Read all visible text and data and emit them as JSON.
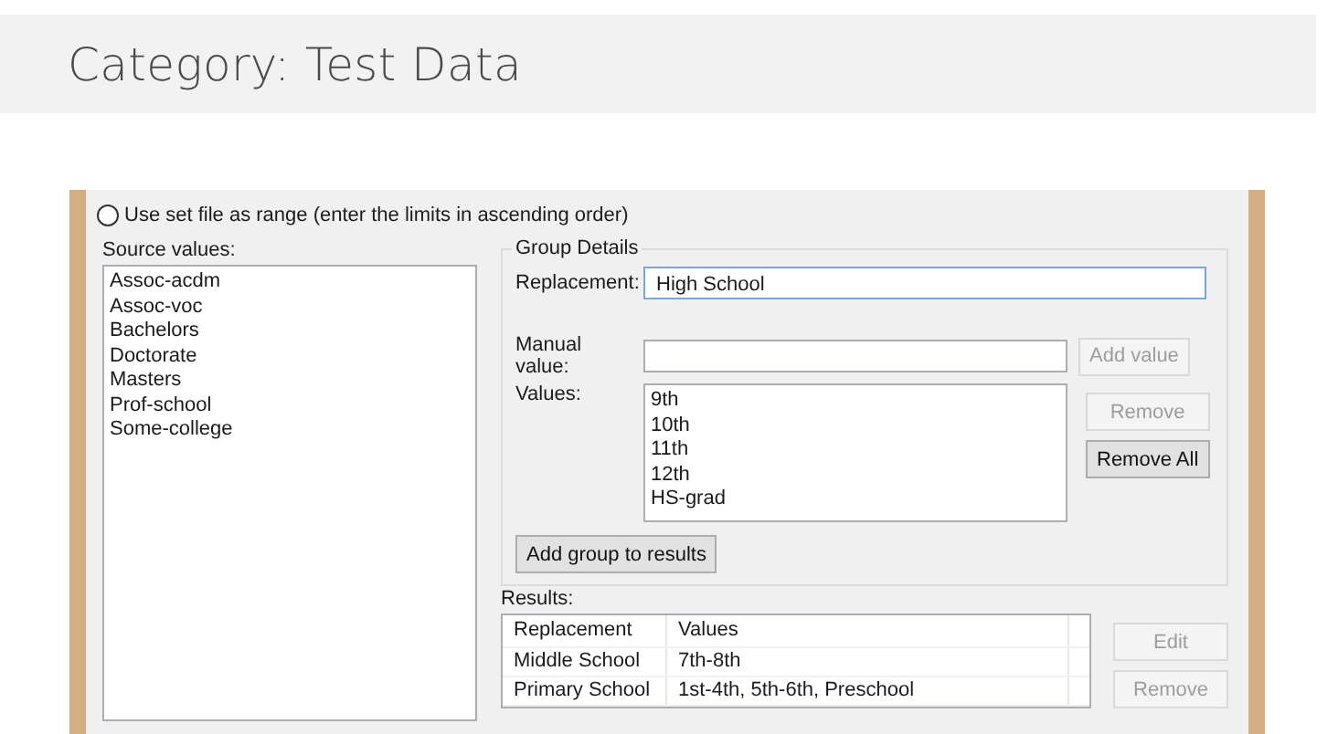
{
  "page_title": "Category: Test Data",
  "range_option": {
    "label": "Use set file as range (enter the limits in ascending order)",
    "selected": false
  },
  "source_values": {
    "label": "Source values:",
    "items": [
      "Assoc-acdm",
      "Assoc-voc",
      "Bachelors",
      "Doctorate",
      "Masters",
      "Prof-school",
      "Some-college"
    ]
  },
  "group_details": {
    "title": "Group Details",
    "replacement": {
      "label": "Replacement:",
      "value": "High School",
      "focused": true
    },
    "manual_value": {
      "label": "Manual value:",
      "focused": false
    },
    "add_value_button": {
      "label": "Add value",
      "disabled": true
    },
    "values": {
      "label": "Values:",
      "items": [
        "9th",
        "10th",
        "11th",
        "12th",
        "HS-grad"
      ]
    },
    "value_buttons": [
      {
        "label": "Remove",
        "disabled": true
      },
      {
        "label": "Remove All",
        "disabled": false
      }
    ],
    "add_group_button": {
      "label": "Add group to results",
      "disabled": false
    }
  },
  "results": {
    "label": "Results:",
    "columns": [
      "Replacement",
      "Values"
    ],
    "rows": [
      {
        "replacement": "Middle School",
        "values": "7th-8th"
      },
      {
        "replacement": "Primary School",
        "values": "1st-4th, 5th-6th, Preschool"
      }
    ],
    "buttons": [
      {
        "label": "Edit",
        "disabled": true
      },
      {
        "label": "Remove",
        "disabled": true
      }
    ]
  }
}
